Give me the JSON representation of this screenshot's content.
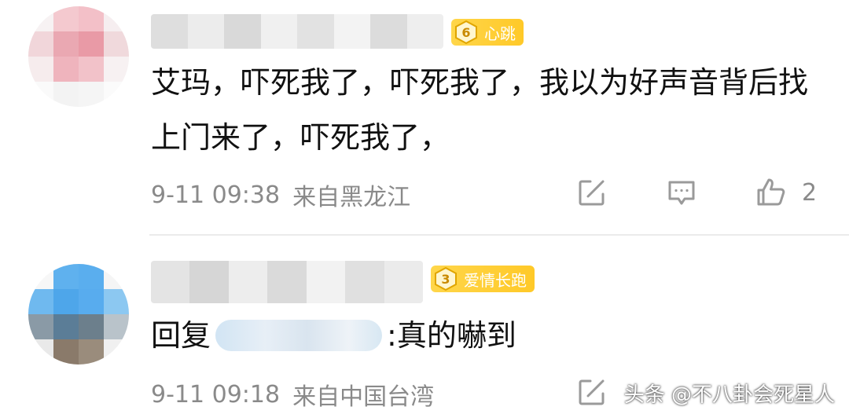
{
  "comments": [
    {
      "badge": {
        "level": "6",
        "name": "心跳"
      },
      "text": "艾玛，吓死我了，吓死我了，我以为好声音背后找上门来了，吓死我了，",
      "time": "9-11 09:38",
      "location": "来自黑龙江",
      "like_count": "2"
    },
    {
      "badge": {
        "level": "3",
        "name": "爱情长跑"
      },
      "reply_prefix": "回复",
      "text": ":真的嚇到",
      "time": "9-11 09:18",
      "location": "来自中国台湾"
    }
  ],
  "watermark": "头条 @不八卦会死星人",
  "colors": {
    "badge_gold": "#ffc928",
    "meta_gray": "#8a8a8a",
    "text": "#111111"
  },
  "icons": [
    "share-icon",
    "comment-icon",
    "like-icon"
  ]
}
